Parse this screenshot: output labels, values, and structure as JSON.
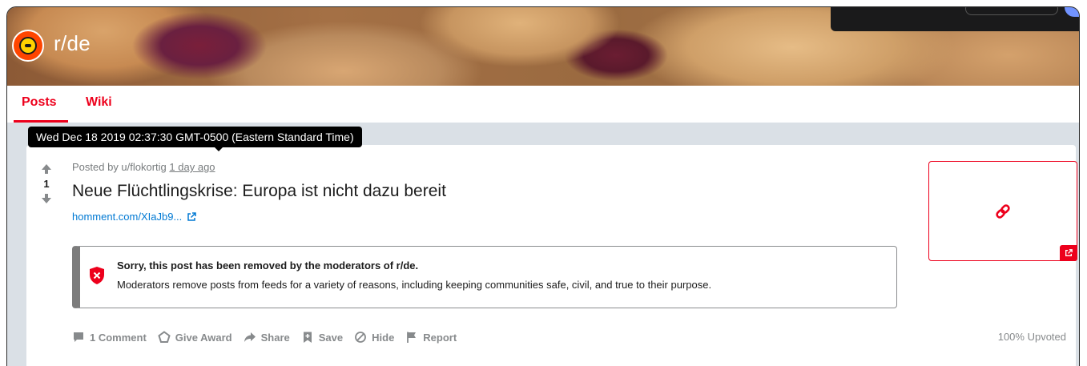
{
  "subreddit": {
    "name": "r/de",
    "icon": "subreddit-avatar-icon"
  },
  "tabs": [
    {
      "label": "Posts",
      "active": true
    },
    {
      "label": "Wiki",
      "active": false
    }
  ],
  "tooltip": {
    "text": "Wed Dec 18 2019 02:37:30 GMT-0500 (Eastern Standard Time)"
  },
  "post": {
    "votes": "1",
    "posted_by_prefix": "Posted by u/flokortig",
    "time_ago": "1 day ago",
    "title": "Neue Flüchtlingskrise: Europa ist nicht dazu bereit",
    "link_text": "homment.com/XIaJb9...",
    "removed": {
      "heading": "Sorry, this post has been removed by the moderators of r/de.",
      "body": "Moderators remove posts from feeds for a variety of reasons, including keeping communities safe, civil, and true to their purpose."
    },
    "actions": {
      "comment": "1 Comment",
      "award": "Give Award",
      "share": "Share",
      "save": "Save",
      "hide": "Hide",
      "report": "Report"
    },
    "upvoted": "100% Upvoted"
  },
  "colors": {
    "accent": "#ed001c",
    "link": "#0079d3",
    "muted": "#878a8c",
    "background": "#dae0e6"
  }
}
